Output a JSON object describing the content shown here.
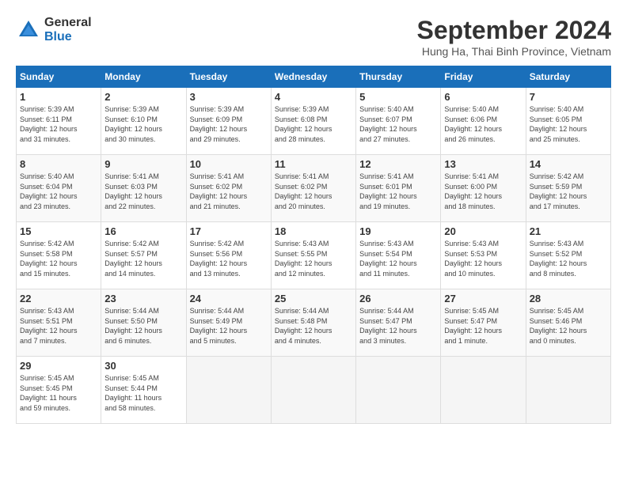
{
  "header": {
    "logo_general": "General",
    "logo_blue": "Blue",
    "month_title": "September 2024",
    "location": "Hung Ha, Thai Binh Province, Vietnam"
  },
  "weekdays": [
    "Sunday",
    "Monday",
    "Tuesday",
    "Wednesday",
    "Thursday",
    "Friday",
    "Saturday"
  ],
  "weeks": [
    [
      {
        "day": 1,
        "sunrise": "5:39 AM",
        "sunset": "6:11 PM",
        "daylight": "12 hours and 31 minutes."
      },
      {
        "day": 2,
        "sunrise": "5:39 AM",
        "sunset": "6:10 PM",
        "daylight": "12 hours and 30 minutes."
      },
      {
        "day": 3,
        "sunrise": "5:39 AM",
        "sunset": "6:09 PM",
        "daylight": "12 hours and 29 minutes."
      },
      {
        "day": 4,
        "sunrise": "5:39 AM",
        "sunset": "6:08 PM",
        "daylight": "12 hours and 28 minutes."
      },
      {
        "day": 5,
        "sunrise": "5:40 AM",
        "sunset": "6:07 PM",
        "daylight": "12 hours and 27 minutes."
      },
      {
        "day": 6,
        "sunrise": "5:40 AM",
        "sunset": "6:06 PM",
        "daylight": "12 hours and 26 minutes."
      },
      {
        "day": 7,
        "sunrise": "5:40 AM",
        "sunset": "6:05 PM",
        "daylight": "12 hours and 25 minutes."
      }
    ],
    [
      {
        "day": 8,
        "sunrise": "5:40 AM",
        "sunset": "6:04 PM",
        "daylight": "12 hours and 23 minutes."
      },
      {
        "day": 9,
        "sunrise": "5:41 AM",
        "sunset": "6:03 PM",
        "daylight": "12 hours and 22 minutes."
      },
      {
        "day": 10,
        "sunrise": "5:41 AM",
        "sunset": "6:02 PM",
        "daylight": "12 hours and 21 minutes."
      },
      {
        "day": 11,
        "sunrise": "5:41 AM",
        "sunset": "6:02 PM",
        "daylight": "12 hours and 20 minutes."
      },
      {
        "day": 12,
        "sunrise": "5:41 AM",
        "sunset": "6:01 PM",
        "daylight": "12 hours and 19 minutes."
      },
      {
        "day": 13,
        "sunrise": "5:41 AM",
        "sunset": "6:00 PM",
        "daylight": "12 hours and 18 minutes."
      },
      {
        "day": 14,
        "sunrise": "5:42 AM",
        "sunset": "5:59 PM",
        "daylight": "12 hours and 17 minutes."
      }
    ],
    [
      {
        "day": 15,
        "sunrise": "5:42 AM",
        "sunset": "5:58 PM",
        "daylight": "12 hours and 15 minutes."
      },
      {
        "day": 16,
        "sunrise": "5:42 AM",
        "sunset": "5:57 PM",
        "daylight": "12 hours and 14 minutes."
      },
      {
        "day": 17,
        "sunrise": "5:42 AM",
        "sunset": "5:56 PM",
        "daylight": "12 hours and 13 minutes."
      },
      {
        "day": 18,
        "sunrise": "5:43 AM",
        "sunset": "5:55 PM",
        "daylight": "12 hours and 12 minutes."
      },
      {
        "day": 19,
        "sunrise": "5:43 AM",
        "sunset": "5:54 PM",
        "daylight": "12 hours and 11 minutes."
      },
      {
        "day": 20,
        "sunrise": "5:43 AM",
        "sunset": "5:53 PM",
        "daylight": "12 hours and 10 minutes."
      },
      {
        "day": 21,
        "sunrise": "5:43 AM",
        "sunset": "5:52 PM",
        "daylight": "12 hours and 8 minutes."
      }
    ],
    [
      {
        "day": 22,
        "sunrise": "5:43 AM",
        "sunset": "5:51 PM",
        "daylight": "12 hours and 7 minutes."
      },
      {
        "day": 23,
        "sunrise": "5:44 AM",
        "sunset": "5:50 PM",
        "daylight": "12 hours and 6 minutes."
      },
      {
        "day": 24,
        "sunrise": "5:44 AM",
        "sunset": "5:49 PM",
        "daylight": "12 hours and 5 minutes."
      },
      {
        "day": 25,
        "sunrise": "5:44 AM",
        "sunset": "5:48 PM",
        "daylight": "12 hours and 4 minutes."
      },
      {
        "day": 26,
        "sunrise": "5:44 AM",
        "sunset": "5:47 PM",
        "daylight": "12 hours and 3 minutes."
      },
      {
        "day": 27,
        "sunrise": "5:45 AM",
        "sunset": "5:47 PM",
        "daylight": "12 hours and 1 minute."
      },
      {
        "day": 28,
        "sunrise": "5:45 AM",
        "sunset": "5:46 PM",
        "daylight": "12 hours and 0 minutes."
      }
    ],
    [
      {
        "day": 29,
        "sunrise": "5:45 AM",
        "sunset": "5:45 PM",
        "daylight": "11 hours and 59 minutes."
      },
      {
        "day": 30,
        "sunrise": "5:45 AM",
        "sunset": "5:44 PM",
        "daylight": "11 hours and 58 minutes."
      },
      null,
      null,
      null,
      null,
      null
    ]
  ]
}
